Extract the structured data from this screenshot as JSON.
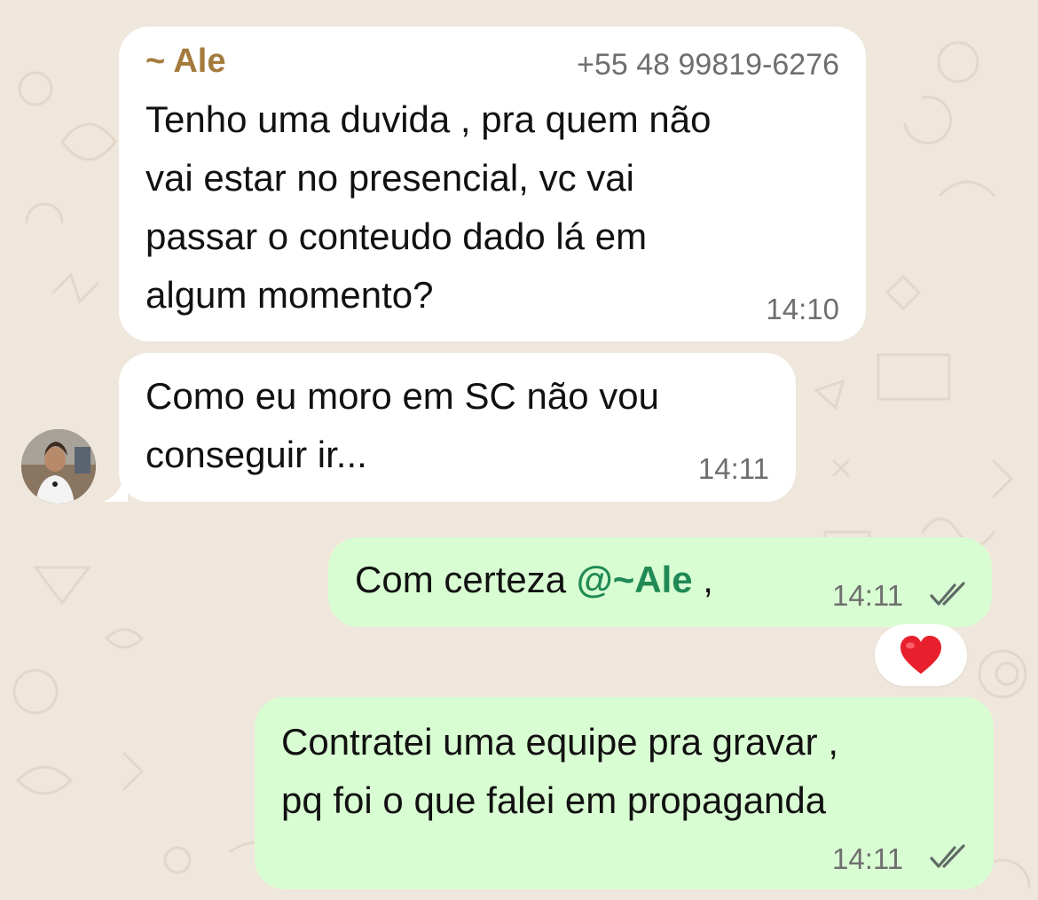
{
  "colors": {
    "wallpaper": "#efe7dc",
    "incoming_bubble": "#ffffff",
    "outgoing_bubble": "#d9fdd3",
    "sender_name": "#a47a3d",
    "mention": "#1f8a55",
    "heart": "#e8202d"
  },
  "messages": [
    {
      "direction": "incoming",
      "sender_name": "~ Ale",
      "sender_phone": "+55 48 99819-6276",
      "text": "Tenho uma duvida , pra quem não\nvai estar no presencial, vc vai\npassar o conteudo dado lá em\nalgum momento?",
      "time": "14:10"
    },
    {
      "direction": "incoming",
      "text": "Como eu moro em SC não vou\nconseguir ir...",
      "time": "14:11",
      "avatar_icon": "contact-avatar"
    },
    {
      "direction": "outgoing",
      "text_before": "Com certeza ",
      "mention": "@~Ale",
      "text_after": " ,",
      "time": "14:11",
      "status_icon": "double-check-icon",
      "reaction_icon": "red-heart-icon"
    },
    {
      "direction": "outgoing",
      "text": "Contratei uma equipe pra gravar ,\npq foi o que falei em propaganda",
      "time": "14:11",
      "status_icon": "double-check-icon"
    }
  ]
}
